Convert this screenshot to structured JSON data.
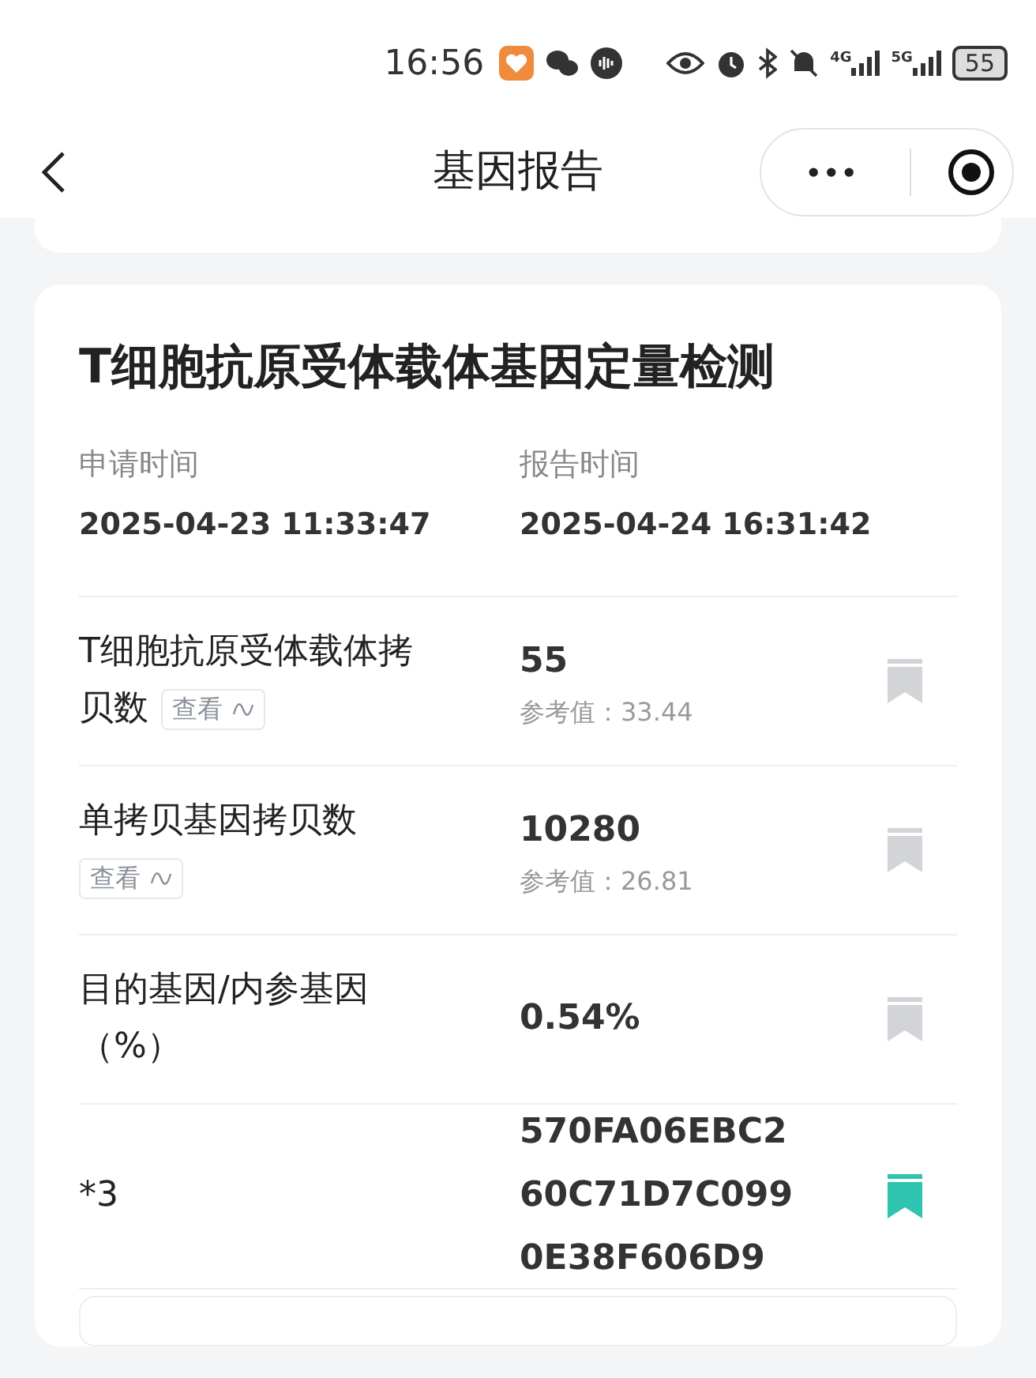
{
  "status_bar": {
    "time": "16:56",
    "network_1": "4G",
    "network_2": "5G",
    "battery": "55"
  },
  "nav": {
    "title": "基因报告",
    "more": "•••"
  },
  "report": {
    "title": "T细胞抗原受体载体基因定量检测",
    "meta": [
      {
        "label": "申请时间",
        "value": "2025-04-23 11:33:47"
      },
      {
        "label": "报告时间",
        "value": "2025-04-24 16:31:42"
      }
    ],
    "rows": [
      {
        "label": [
          "T细胞抗原受体载体拷",
          "贝数"
        ],
        "view": "查看",
        "value": [
          "55"
        ],
        "reference": "参考值：33.44",
        "marked": false
      },
      {
        "label": [
          "单拷贝基因拷贝数"
        ],
        "view": "查看",
        "value": [
          "10280"
        ],
        "reference": "参考值：26.81",
        "marked": false
      },
      {
        "label": [
          "目的基因/内参基因",
          "（%）"
        ],
        "value": [
          "0.54%"
        ],
        "marked": false
      },
      {
        "label": [
          "*3"
        ],
        "value": [
          "570FA06EBC2",
          "60C71D7C099",
          "0E38F606D9"
        ],
        "marked": true
      }
    ]
  }
}
